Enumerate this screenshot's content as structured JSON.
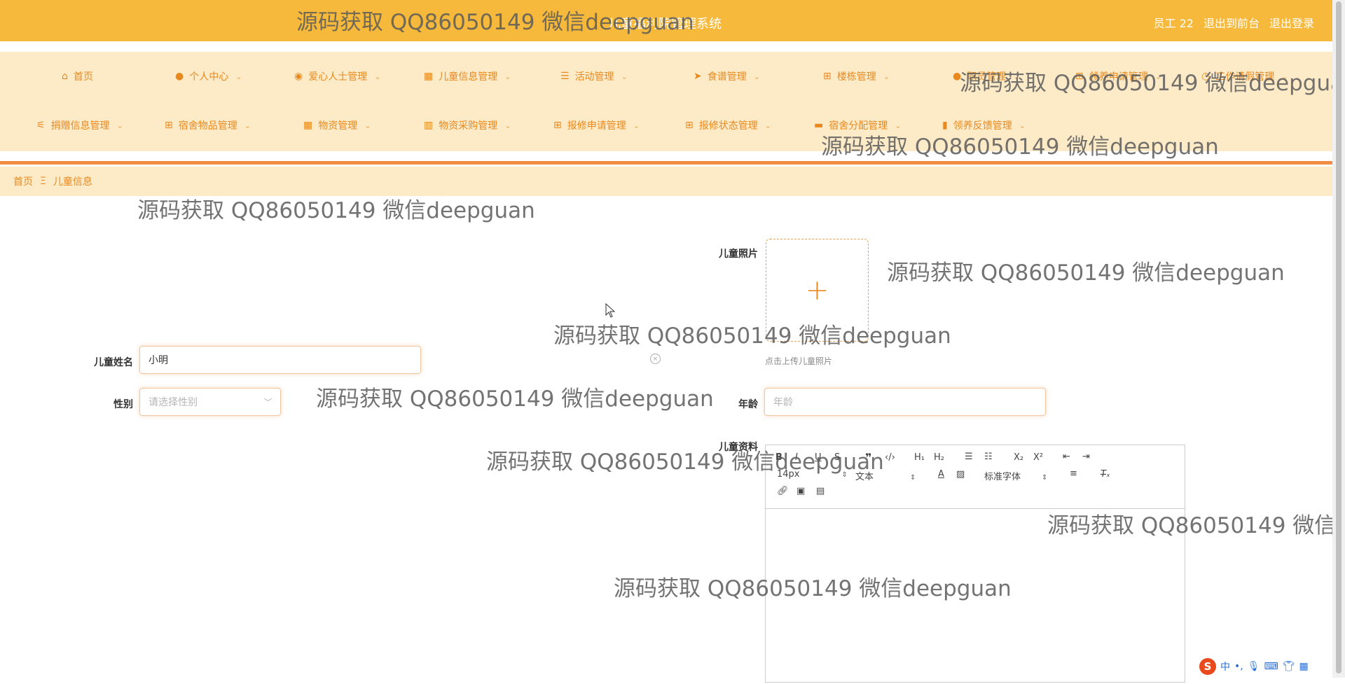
{
  "header": {
    "title": "儿童福利院管理系统",
    "user": "员工 22",
    "to_frontend": "退出到前台",
    "logout": "退出登录"
  },
  "nav": {
    "row1": [
      {
        "label": "首页",
        "icon": "home-icon",
        "dropdown": false
      },
      {
        "label": "个人中心",
        "icon": "user-icon",
        "dropdown": true
      },
      {
        "label": "爱心人士管理",
        "icon": "map-pin-icon",
        "dropdown": true
      },
      {
        "label": "儿童信息管理",
        "icon": "grid-icon",
        "dropdown": true
      },
      {
        "label": "活动管理",
        "icon": "list-icon",
        "dropdown": true
      },
      {
        "label": "食谱管理",
        "icon": "send-icon",
        "dropdown": true
      },
      {
        "label": "楼栋管理",
        "icon": "apps-icon",
        "dropdown": true
      },
      {
        "label": "职员管理",
        "icon": "user-icon",
        "dropdown": true
      },
      {
        "label": "领养申请管理",
        "icon": "apps-icon",
        "dropdown": true
      },
      {
        "label": "工作请假管理",
        "icon": "clock-icon",
        "dropdown": true
      }
    ],
    "row2": [
      {
        "label": "捐赠信息管理",
        "icon": "sliders-icon",
        "dropdown": true
      },
      {
        "label": "宿舍物品管理",
        "icon": "apps-icon",
        "dropdown": true
      },
      {
        "label": "物资管理",
        "icon": "grid-icon",
        "dropdown": true
      },
      {
        "label": "物资采购管理",
        "icon": "books-icon",
        "dropdown": true
      },
      {
        "label": "报修申请管理",
        "icon": "apps-icon",
        "dropdown": true
      },
      {
        "label": "报修状态管理",
        "icon": "apps-icon",
        "dropdown": true
      },
      {
        "label": "宿舍分配管理",
        "icon": "chat-icon",
        "dropdown": true
      },
      {
        "label": "领养反馈管理",
        "icon": "chart-icon",
        "dropdown": true
      }
    ]
  },
  "breadcrumb": {
    "home": "首页",
    "separator": "Ξ",
    "current": "儿童信息"
  },
  "form": {
    "photo_label": "儿童照片",
    "photo_hint": "点击上传儿童照片",
    "name_label": "儿童姓名",
    "name_value": "小明",
    "gender_label": "性别",
    "gender_placeholder": "请选择性别",
    "age_label": "年龄",
    "age_placeholder": "年龄",
    "info_label": "儿童资料"
  },
  "editor": {
    "font_size": "14px",
    "block_type": "文本",
    "font_family": "标准字体"
  },
  "watermark": "源码获取 QQ86050149 微信deepguan",
  "ime": {
    "lang": "中"
  }
}
